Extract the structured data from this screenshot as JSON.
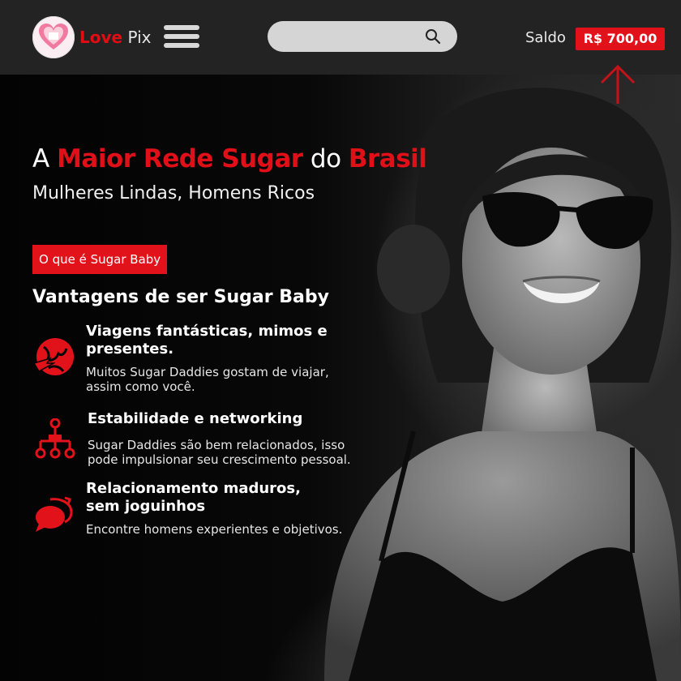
{
  "header": {
    "brand_part1": "Love",
    "brand_part2": " Pix",
    "search": {
      "placeholder": "",
      "value": ""
    },
    "saldo_label": "Saldo",
    "saldo_value": "R$ 700,00"
  },
  "hero": {
    "title": {
      "w1": "A ",
      "w2": "Maior Rede Sugar",
      "w3": " do ",
      "w4": "Brasil"
    },
    "subtitle": "Mulheres Lindas, Homens Ricos",
    "button_label": "O que é Sugar Baby",
    "section_title": "Vantagens de ser Sugar Baby",
    "features": [
      {
        "icon": "globe-plane-icon",
        "title_line1": "Viagens fantásticas, mimos e",
        "title_line2": "presentes.",
        "desc_line1": "Muitos Sugar Daddies gostam de viajar,",
        "desc_line2": "assim como você."
      },
      {
        "icon": "network-icon",
        "title_line1": "Estabilidade e networking",
        "desc_line1": "Sugar Daddies são bem relacionados, isso",
        "desc_line2": "pode impulsionar seu crescimento pessoal."
      },
      {
        "icon": "chat-bubbles-icon",
        "title_line1": "Relacionamento maduros,",
        "title_line2": "sem joguinhos",
        "desc_line1": "Encontre homens experientes e objetivos."
      }
    ]
  },
  "colors": {
    "accent_red": "#e2121b",
    "header_bg": "#232323",
    "page_bg": "#050505"
  }
}
